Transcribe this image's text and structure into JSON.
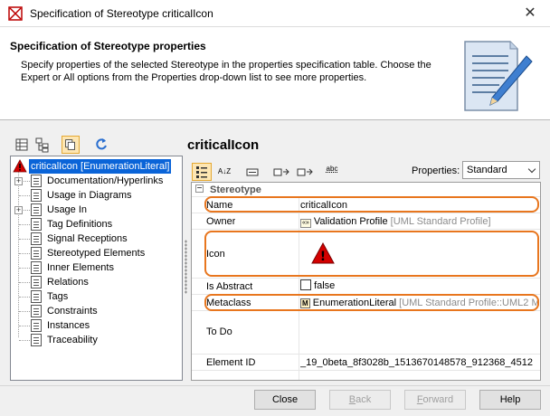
{
  "window": {
    "title": "Specification of Stereotype criticalIcon",
    "close_glyph": "✕"
  },
  "header": {
    "title": "Specification of Stereotype properties",
    "description": "Specify properties of the selected Stereotype in the properties specification table. Choose the Expert or All options from the Properties drop-down list to see more properties."
  },
  "left_toolbar": [
    "table-view-icon",
    "tree-view-icon",
    "copy-icon",
    "refresh-icon"
  ],
  "tree": {
    "root": "criticalIcon [EnumerationLiteral]",
    "items": [
      {
        "label": "Documentation/Hyperlinks",
        "expandable": true
      },
      {
        "label": "Usage in Diagrams",
        "expandable": false
      },
      {
        "label": "Usage In",
        "expandable": true
      },
      {
        "label": "Tag Definitions",
        "expandable": false
      },
      {
        "label": "Signal Receptions",
        "expandable": false
      },
      {
        "label": "Stereotyped Elements",
        "expandable": false
      },
      {
        "label": "Inner Elements",
        "expandable": false
      },
      {
        "label": "Relations",
        "expandable": false
      },
      {
        "label": "Tags",
        "expandable": false
      },
      {
        "label": "Constraints",
        "expandable": false
      },
      {
        "label": "Instances",
        "expandable": false
      },
      {
        "label": "Traceability",
        "expandable": false
      }
    ]
  },
  "element_title": "criticalIcon",
  "properties_toolbar": {
    "properties_label": "Properties:",
    "properties_value": "Standard",
    "sort_glyph": "A↓Z",
    "filter_glyph": "abc"
  },
  "grid": {
    "group": "Stereotype",
    "group_toggle": "−",
    "rows": {
      "name": {
        "label": "Name",
        "value": "criticalIcon"
      },
      "owner": {
        "label": "Owner",
        "value": "Validation Profile",
        "suffix": "[UML Standard Profile]",
        "icon_glyph": "«»"
      },
      "icon": {
        "label": "Icon",
        "value": "!"
      },
      "is_abstract": {
        "label": "Is Abstract",
        "value": "false"
      },
      "metaclass": {
        "label": "Metaclass",
        "value": "EnumerationLiteral",
        "suffix": "[UML Standard Profile::UML2 M",
        "icon_glyph": "M"
      },
      "to_do": {
        "label": "To Do",
        "value": ""
      },
      "element_id": {
        "label": "Element ID",
        "value": "_19_0beta_8f3028b_1513670148578_912368_4512"
      }
    }
  },
  "footer": {
    "close": "Close",
    "back_mnemonic": "B",
    "back_rest": "ack",
    "forward_mnemonic": "F",
    "forward_rest": "orward",
    "help": "Help"
  },
  "colors": {
    "selection": "#0a64d8",
    "highlight": "#e8761e",
    "warning": "#d40000"
  }
}
